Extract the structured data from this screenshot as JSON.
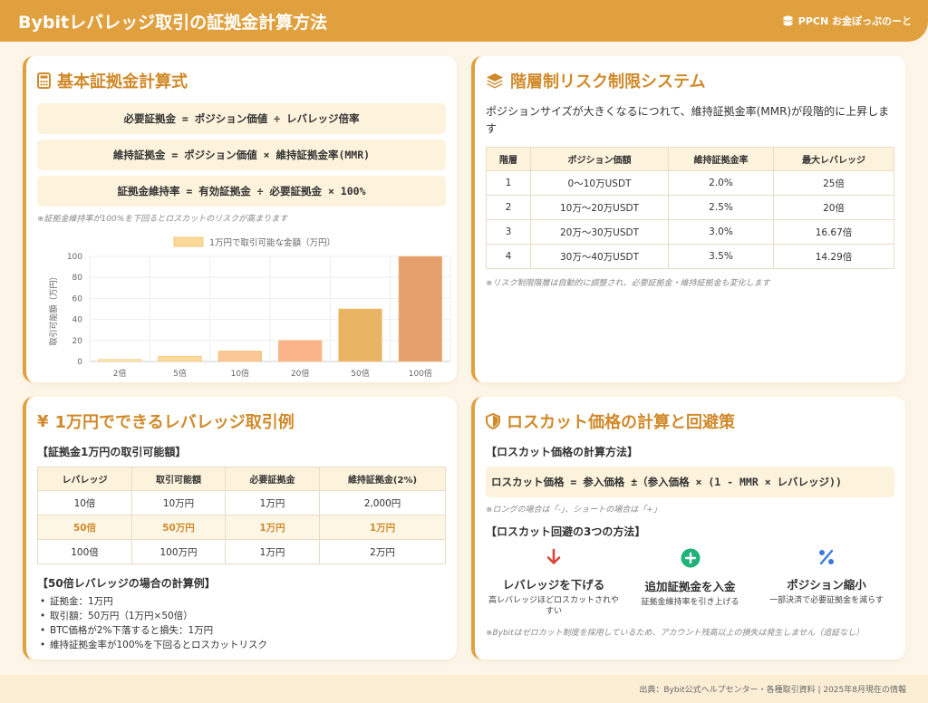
{
  "header": {
    "title": "Bybitレバレッジ取引の証拠金計算方法",
    "brand": "PPCN お金ぽっぷのーと",
    "brand_icon": "coins-icon"
  },
  "basic": {
    "title": "基本証拠金計算式",
    "icon": "calculator-icon",
    "formulas": [
      "必要証拠金 = ポジション価値 ÷ レバレッジ倍率",
      "維持証拠金 = ポジション価値 × 維持証拠金率(MMR)",
      "証拠金維持率 = 有効証拠金 ÷ 必要証拠金 × 100%"
    ],
    "note": "※証拠金維持率が100%を下回るとロスカットのリスクが高まります"
  },
  "chart_data": {
    "type": "bar",
    "categories": [
      "2倍",
      "5倍",
      "10倍",
      "20倍",
      "50倍",
      "100倍"
    ],
    "series": [
      {
        "name": "1万円で取引可能な金額（万円）",
        "values": [
          2,
          5,
          10,
          20,
          50,
          100
        ]
      }
    ],
    "ylabel": "取引可能額（万円）",
    "xlabel": "",
    "ylim": [
      0,
      100
    ],
    "yticks": [
      0,
      20,
      40,
      60,
      80,
      100
    ],
    "colors": [
      "#fbe9b4",
      "#fbd99a",
      "#fbc796",
      "#fbb48a",
      "#e8b464",
      "#e6a06c"
    ],
    "legend": "top",
    "grid": true
  },
  "risk": {
    "title": "階層制リスク制限システム",
    "icon": "layers-icon",
    "desc": "ポジションサイズが大きくなるにつれて、維持証拠金率(MMR)が段階的に上昇します",
    "headers": [
      "階層",
      "ポジション価額",
      "維持証拠金率",
      "最大レバレッジ"
    ],
    "rows": [
      [
        "1",
        "0〜10万USDT",
        "2.0%",
        "25倍"
      ],
      [
        "2",
        "10万〜20万USDT",
        "2.5%",
        "20倍"
      ],
      [
        "3",
        "20万〜30万USDT",
        "3.0%",
        "16.67倍"
      ],
      [
        "4",
        "30万〜40万USDT",
        "3.5%",
        "14.29倍"
      ]
    ],
    "note": "※リスク制限階層は自動的に調整され、必要証拠金・維持証拠金も変化します"
  },
  "example": {
    "title": "1万円でできるレバレッジ取引例",
    "icon": "yen-icon",
    "subtitle": "【証拠金1万円の取引可能額】",
    "headers": [
      "レバレッジ",
      "取引可能額",
      "必要証拠金",
      "維持証拠金(2%)"
    ],
    "rows": [
      [
        "10倍",
        "10万円",
        "1万円",
        "2,000円"
      ],
      [
        "50倍",
        "50万円",
        "1万円",
        "1万円"
      ],
      [
        "100倍",
        "100万円",
        "1万円",
        "2万円"
      ]
    ],
    "highlight_row": 1,
    "calc_title": "【50倍レバレッジの場合の計算例】",
    "calc_items": [
      "証拠金：1万円",
      "取引額：50万円（1万円×50倍）",
      "BTC価格が2%下落すると損失：1万円",
      "維持証拠金率が100%を下回るとロスカットリスク"
    ]
  },
  "losscut": {
    "title": "ロスカット価格の計算と回避策",
    "icon": "shield-icon",
    "calc_title": "【ロスカット価格の計算方法】",
    "formula": "ロスカット価格 = 参入価格 ±（参入価格 × (1 - MMR × レバレッジ))",
    "formula_note": "※ロングの場合は「-」、ショートの場合は「+」",
    "methods_title": "【ロスカット回避の3つの方法】",
    "methods": [
      {
        "icon": "arrow-down-icon",
        "title": "レバレッジを下げる",
        "desc": "高レバレッジほどロスカットされやすい"
      },
      {
        "icon": "plus-circle-icon",
        "title": "追加証拠金を入金",
        "desc": "証拠金維持率を引き上げる"
      },
      {
        "icon": "percent-icon",
        "title": "ポジション縮小",
        "desc": "一部決済で必要証拠金を減らす"
      }
    ],
    "note": "※Bybitはゼロカット制度を採用しているため、アカウント残高以上の損失は発生しません（追証なし）"
  },
  "footer": {
    "source": "出典：Bybit公式ヘルプセンター・各種取引資料 | 2025年8月現在の情報"
  }
}
